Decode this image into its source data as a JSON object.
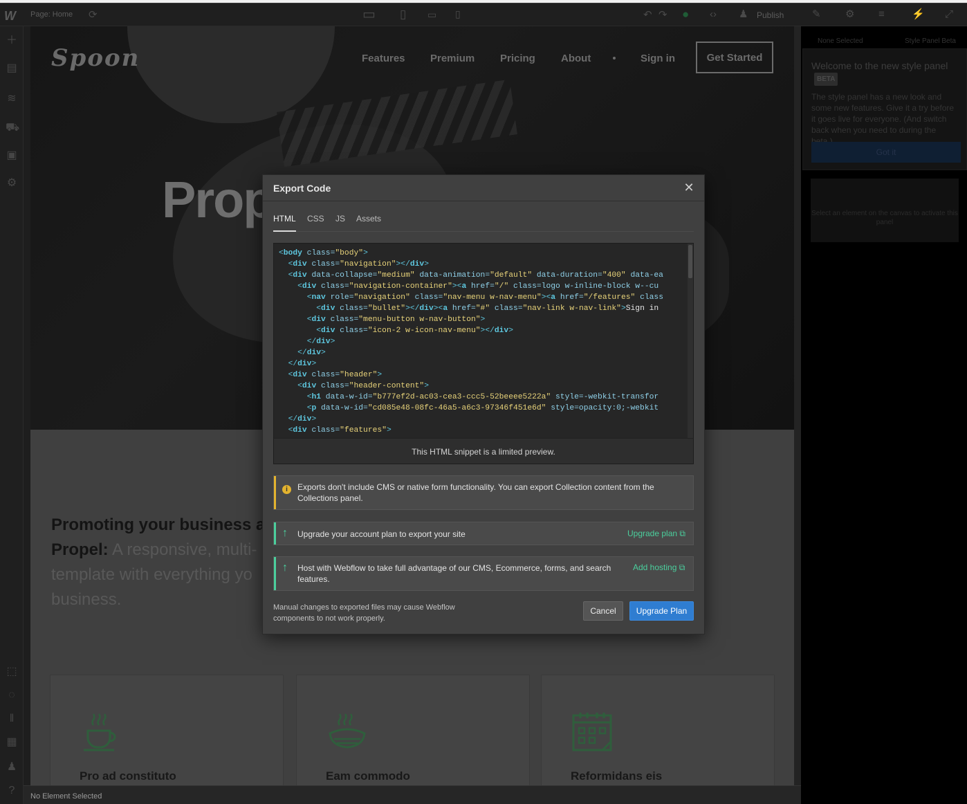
{
  "toolbar": {
    "logo": "W",
    "page_label": "Page: Home",
    "publish_label": "Publish"
  },
  "site": {
    "logo_text": "Spoon",
    "nav": [
      "Features",
      "Premium",
      "Pricing",
      "About",
      "Sign in"
    ],
    "cta": "Get Started",
    "hero_heading": "Prop",
    "promo_bold": "Promoting your business a",
    "promo_name": "Propel:",
    "promo_rest": " A responsive, multi-",
    "promo_line3": "template with everything yo",
    "promo_line4": "business.",
    "cards": [
      {
        "title": "Pro ad constituto",
        "icon": "coffee-cup-icon"
      },
      {
        "title": "Eam commodo",
        "icon": "hot-food-icon"
      },
      {
        "title": "Reformidans eis",
        "icon": "calendar-icon"
      }
    ]
  },
  "style_panel": {
    "tab_left": "None Selected",
    "tab_right": "Style Panel Beta",
    "welcome_title": "Welcome to the new style panel",
    "beta_badge": "BETA",
    "welcome_body": "The style panel has a new look and some new features. Give it a try before it goes live for everyone. (And switch back when you need to during the beta.)",
    "got_it": "Got it",
    "select_note": "Select an element on the canvas to activate this panel"
  },
  "status": {
    "text": "No Element Selected"
  },
  "modal": {
    "title": "Export Code",
    "tabs": [
      "HTML",
      "CSS",
      "JS",
      "Assets"
    ],
    "active_tab": "HTML",
    "code_lines": [
      "<body class=\"body\">",
      "  <div class=\"navigation\"></div>",
      "  <div data-collapse=\"medium\" data-animation=\"default\" data-duration=\"400\" data-ea",
      "    <div class=\"navigation-container\"><a href=\"/\" class=\"logo w-inline-block w--cu",
      "      <nav role=\"navigation\" class=\"nav-menu w-nav-menu\"><a href=\"/features\" class",
      "        <div class=\"bullet\"></div><a href=\"#\" class=\"nav-link w-nav-link\">Sign in<",
      "      <div class=\"menu-button w-nav-button\">",
      "        <div class=\"icon-2 w-icon-nav-menu\"></div>",
      "      </div>",
      "    </div>",
      "  </div>",
      "  <div class=\"header\">",
      "    <div class=\"header-content\">",
      "      <h1 data-w-id=\"b777ef2d-ac03-cea3-ccc5-52beeee5222a\" style=\"-webkit-transfor",
      "      <p data-w-id=\"cd085e48-08fc-46a5-a6c3-97346f451e6d\" style=\"opacity:0;-webkit",
      "  </div>",
      "  <div class=\"features\">"
    ],
    "code_footer": "This HTML snippet is a limited preview.",
    "notice_cms": "Exports don't include CMS or native form functionality. You can export Collection content from the Collections panel.",
    "notice_upgrade": "Upgrade your account plan to export your site",
    "notice_upgrade_link": "Upgrade plan",
    "notice_hosting": "Host with Webflow to take full advantage of our CMS, Ecommerce, forms, and search features.",
    "notice_hosting_link": "Add hosting",
    "footnote": "Manual changes to exported files may cause Webflow components to not work properly.",
    "cancel_label": "Cancel",
    "upgrade_label": "Upgrade Plan",
    "colors": {
      "accent_blue": "#2f7dd1",
      "success_green": "#4bcf9d",
      "warning_yellow": "#e3b32f"
    }
  }
}
